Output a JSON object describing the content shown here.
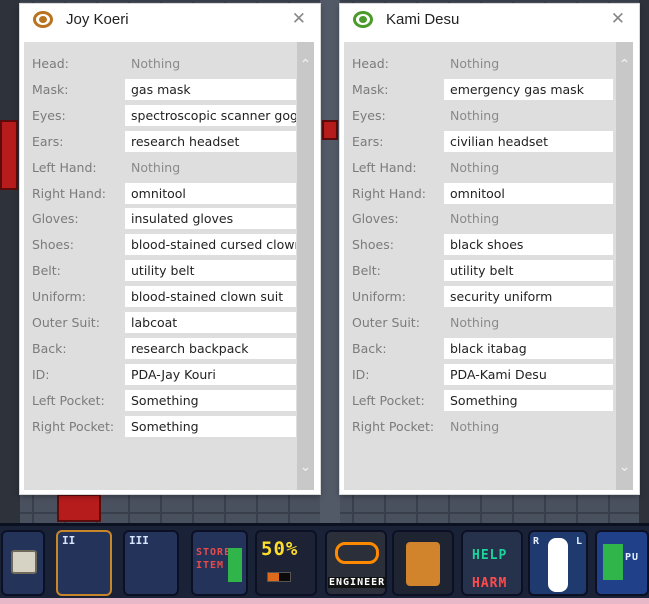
{
  "windows": [
    {
      "title": "Joy Koeri",
      "eye_color": "#b8731f",
      "slots": [
        {
          "label": "Head:",
          "value": "Nothing",
          "empty": true
        },
        {
          "label": "Mask:",
          "value": "gas mask",
          "empty": false
        },
        {
          "label": "Eyes:",
          "value": "spectroscopic scanner goggles",
          "empty": false
        },
        {
          "label": "Ears:",
          "value": "research headset",
          "empty": false
        },
        {
          "label": "Left Hand:",
          "value": "Nothing",
          "empty": true
        },
        {
          "label": "Right Hand:",
          "value": "omnitool",
          "empty": false
        },
        {
          "label": "Gloves:",
          "value": "insulated gloves",
          "empty": false
        },
        {
          "label": "Shoes:",
          "value": "blood-stained cursed clown shoes",
          "empty": false
        },
        {
          "label": "Belt:",
          "value": "utility belt",
          "empty": false
        },
        {
          "label": "Uniform:",
          "value": "blood-stained clown suit",
          "empty": false
        },
        {
          "label": "Outer Suit:",
          "value": "labcoat",
          "empty": false
        },
        {
          "label": "Back:",
          "value": "research backpack",
          "empty": false
        },
        {
          "label": "ID:",
          "value": "PDA-Jay Kouri",
          "empty": false
        },
        {
          "label": "Left Pocket:",
          "value": "Something",
          "empty": false
        },
        {
          "label": "Right Pocket:",
          "value": "Something",
          "empty": false
        }
      ]
    },
    {
      "title": "Kami Desu",
      "eye_color": "#4a9a2c",
      "slots": [
        {
          "label": "Head:",
          "value": "Nothing",
          "empty": true
        },
        {
          "label": "Mask:",
          "value": "emergency gas mask",
          "empty": false
        },
        {
          "label": "Eyes:",
          "value": "Nothing",
          "empty": true
        },
        {
          "label": "Ears:",
          "value": "civilian headset",
          "empty": false
        },
        {
          "label": "Left Hand:",
          "value": "Nothing",
          "empty": true
        },
        {
          "label": "Right Hand:",
          "value": "omnitool",
          "empty": false
        },
        {
          "label": "Gloves:",
          "value": "Nothing",
          "empty": true
        },
        {
          "label": "Shoes:",
          "value": "black shoes",
          "empty": false
        },
        {
          "label": "Belt:",
          "value": "utility belt",
          "empty": false
        },
        {
          "label": "Uniform:",
          "value": "security uniform",
          "empty": false
        },
        {
          "label": "Outer Suit:",
          "value": "Nothing",
          "empty": true
        },
        {
          "label": "Back:",
          "value": "black itabag",
          "empty": false
        },
        {
          "label": "ID:",
          "value": "PDA-Kami Desu",
          "empty": false
        },
        {
          "label": "Left Pocket:",
          "value": "Something",
          "empty": false
        },
        {
          "label": "Right Pocket:",
          "value": "Nothing",
          "empty": true
        }
      ]
    }
  ],
  "hud": {
    "hand_slot_left": "II",
    "hand_slot_right": "III",
    "store_item": "STORE ITEM",
    "health_percent": "50%",
    "job_label": "ENGINEER",
    "intent_help": "HELP",
    "intent_harm": "HARM",
    "doll_left": "R",
    "doll_right": "L",
    "pull_label": "PU"
  },
  "icons": {
    "window_eye": "eye-icon",
    "close": "close-icon",
    "scroll_up": "chevron-up-icon",
    "scroll_down": "chevron-down-icon"
  }
}
